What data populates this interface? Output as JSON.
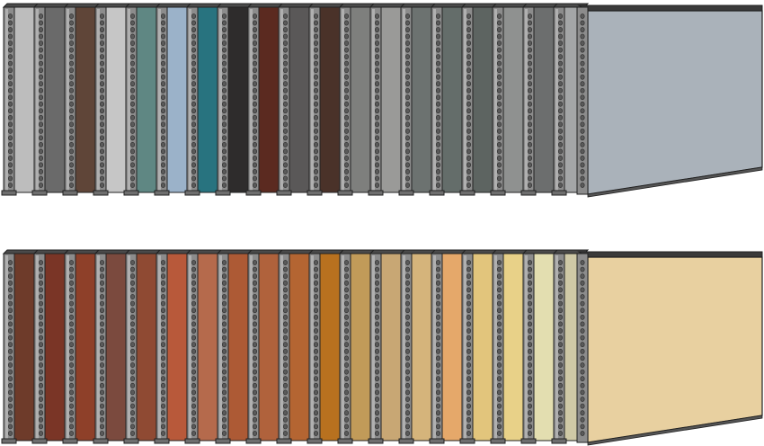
{
  "rows": [
    {
      "id": "cool-row",
      "colors": [
        "#bdbdbd",
        "#6a6a6a",
        "#5f4538",
        "#c6c6c6",
        "#5f8783",
        "#9bb2c9",
        "#28737f",
        "#2e2c2c",
        "#5b2a20",
        "#5a5858",
        "#4a3229",
        "#7e7f7d",
        "#9a9a98",
        "#6c7270",
        "#646d6a",
        "#5d6461",
        "#8f9190",
        "#6c6e6e",
        "#a4a6a7"
      ],
      "front_color": "#aab2ba"
    },
    {
      "id": "warm-row",
      "colors": [
        "#6e3b2a",
        "#7a3526",
        "#8e4029",
        "#7b4a3e",
        "#8f4a33",
        "#b8593a",
        "#b56a4c",
        "#ad5a35",
        "#b0623c",
        "#b46532",
        "#b8711f",
        "#c19b59",
        "#c8a774",
        "#d5b47b",
        "#e5a86a",
        "#e2c57c",
        "#e8d188",
        "#e3deb0",
        "#cfc9a6"
      ],
      "front_color": "#e8d0a0"
    }
  ]
}
